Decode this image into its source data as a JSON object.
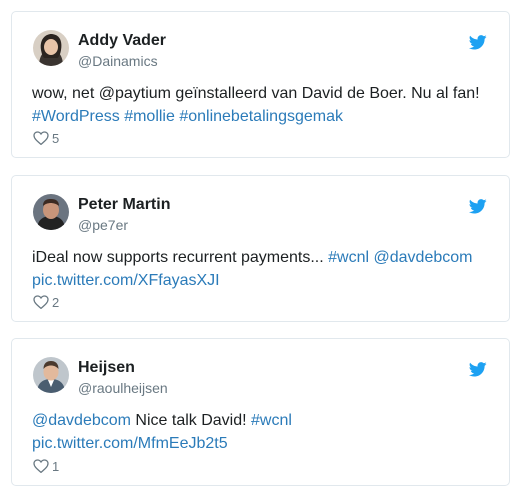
{
  "colors": {
    "link": "#2b7bb9",
    "text": "#1c2022",
    "muted": "#697882",
    "twitter": "#1da1f2",
    "border": "#e1e8ed"
  },
  "tweets": [
    {
      "name": "Addy Vader",
      "handle": "@Dainamics",
      "text_plain": "wow, net @paytium geïnstalleerd van David de Boer. Nu al fan!",
      "hashtag_1": "#WordPress",
      "hashtag_2": "#mollie",
      "hashtag_3": "#onlinebetalingsgemak",
      "likes": "5",
      "icons": [
        "avatar",
        "twitter-bird-icon",
        "heart-icon"
      ]
    },
    {
      "name": "Peter Martin",
      "handle": "@pe7er",
      "text_plain": "iDeal now supports recurrent payments...",
      "hashtag_1": "#wcnl",
      "mention_1": "@davdebcom",
      "pic_link": "pic.twitter.com/XFfayasXJI",
      "likes": "2",
      "icons": [
        "avatar",
        "twitter-bird-icon",
        "heart-icon"
      ]
    },
    {
      "name": "Heijsen",
      "handle": "@raoulheijsen",
      "mention_1": "@davdebcom",
      "text_plain": "Nice talk David!",
      "hashtag_1": "#wcnl",
      "pic_link": "pic.twitter.com/MfmEeJb2t5",
      "likes": "1",
      "icons": [
        "avatar",
        "twitter-bird-icon",
        "heart-icon"
      ]
    }
  ]
}
